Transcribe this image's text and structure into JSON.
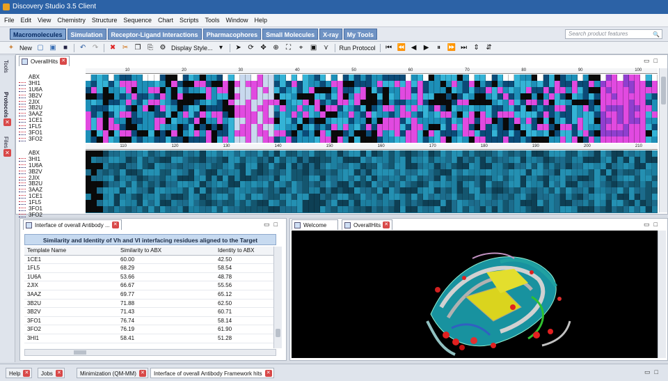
{
  "app": {
    "title": "Discovery Studio 3.5 Client"
  },
  "menu": [
    "File",
    "Edit",
    "View",
    "Chemistry",
    "Structure",
    "Sequence",
    "Chart",
    "Scripts",
    "Tools",
    "Window",
    "Help"
  ],
  "modules": [
    "Macromolecules",
    "Simulation",
    "Receptor-Ligand Interactions",
    "Pharmacophores",
    "Small Molecules",
    "X-ray",
    "My Tools"
  ],
  "search": {
    "placeholder": "Search product features"
  },
  "toolbar": {
    "new_label": "New",
    "display_style_label": "Display Style...",
    "run_protocol_label": "Run Protocol"
  },
  "left_tabs": [
    "Tools",
    "Protocols",
    "Files"
  ],
  "sequence_window": {
    "tab_label": "OverallHits",
    "names": [
      "ABX",
      "3HI1",
      "1U6A",
      "3B2V",
      "2JIX",
      "3B2U",
      "3AAZ",
      "1CE1",
      "1FL5",
      "3FO1",
      "3FO2"
    ],
    "ruler_top": [
      "10",
      "20",
      "30",
      "40",
      "50",
      "60",
      "70",
      "80",
      "90",
      "100"
    ],
    "ruler_bottom": [
      "110",
      "120",
      "130",
      "140",
      "150",
      "160",
      "170",
      "180",
      "190",
      "200",
      "210"
    ]
  },
  "results_window": {
    "tab_label": "Interface of overall Antibody ...",
    "header": "Similarity and Identity of Vh and Vl interfacing residues aligned to the Target",
    "columns": [
      "Template Name",
      "Similarity to ABX",
      "Identity to ABX"
    ],
    "rows": [
      {
        "name": "1CE1",
        "sim": "60.00",
        "id": "42.50"
      },
      {
        "name": "1FL5",
        "sim": "68.29",
        "id": "58.54"
      },
      {
        "name": "1U6A",
        "sim": "53.66",
        "id": "48.78"
      },
      {
        "name": "2JIX",
        "sim": "66.67",
        "id": "55.56"
      },
      {
        "name": "3AAZ",
        "sim": "69.77",
        "id": "65.12"
      },
      {
        "name": "3B2U",
        "sim": "71.88",
        "id": "62.50"
      },
      {
        "name": "3B2V",
        "sim": "71.43",
        "id": "60.71"
      },
      {
        "name": "3FO1",
        "sim": "76.74",
        "id": "58.14"
      },
      {
        "name": "3FO2",
        "sim": "76.19",
        "id": "61.90"
      },
      {
        "name": "3HI1",
        "sim": "58.41",
        "id": "51.28"
      }
    ]
  },
  "viewer_tabs": [
    "Welcome",
    "OverallHits"
  ],
  "bottom_tabs": [
    "Help",
    "Jobs",
    "Minimization (QM-MM)",
    "Interface of overall Antibody Framework hits"
  ]
}
